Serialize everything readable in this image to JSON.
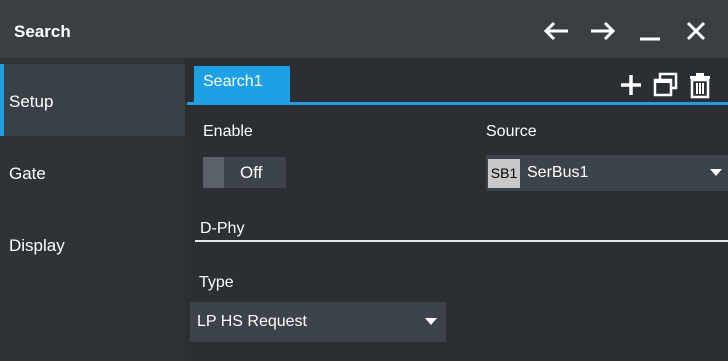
{
  "window": {
    "title": "Search",
    "buttons": [
      "arrow-left-icon",
      "arrow-right-icon",
      "minimize-icon",
      "close-icon"
    ]
  },
  "sidebar": {
    "items": [
      {
        "label": "Setup",
        "active": true
      },
      {
        "label": "Gate",
        "active": false
      },
      {
        "label": "Display",
        "active": false
      }
    ]
  },
  "tabs": {
    "active": "Search1",
    "tools": [
      "add-icon",
      "duplicate-icon",
      "delete-icon"
    ]
  },
  "form": {
    "enable_label": "Enable",
    "enable_value": "Off",
    "source_label": "Source",
    "source_badge": "SB1",
    "source_value": "SerBus1",
    "section_title": "D-Phy",
    "type_label": "Type",
    "type_value": "LP HS Request"
  },
  "colors": {
    "accent": "#1ea0e6",
    "background": "#2b2f33",
    "titlebar": "#3a3f44"
  }
}
